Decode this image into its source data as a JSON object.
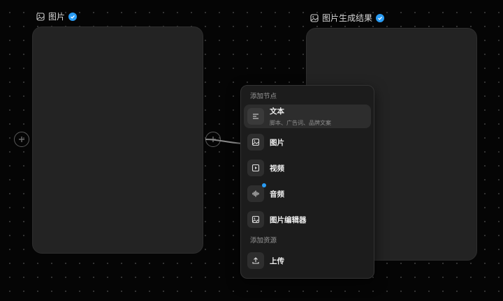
{
  "nodes": {
    "left": {
      "title": "图片"
    },
    "right": {
      "title": "图片生成结果"
    }
  },
  "menu": {
    "section_add_node": "添加节点",
    "items": [
      {
        "label": "文本",
        "sub": "脚本、广告词、品牌文案",
        "icon": "text-lines-icon"
      },
      {
        "label": "图片",
        "icon": "image-icon"
      },
      {
        "label": "视频",
        "icon": "video-play-icon"
      },
      {
        "label": "音频",
        "icon": "audio-wave-icon"
      },
      {
        "label": "图片编辑器",
        "icon": "image-edit-icon"
      }
    ],
    "section_add_resource": "添加资源",
    "upload": {
      "label": "上传",
      "icon": "upload-icon"
    }
  },
  "colors": {
    "accent": "#2a9cf4",
    "card": "#232323",
    "menu": "#1c1c1c",
    "background": "#050505"
  }
}
